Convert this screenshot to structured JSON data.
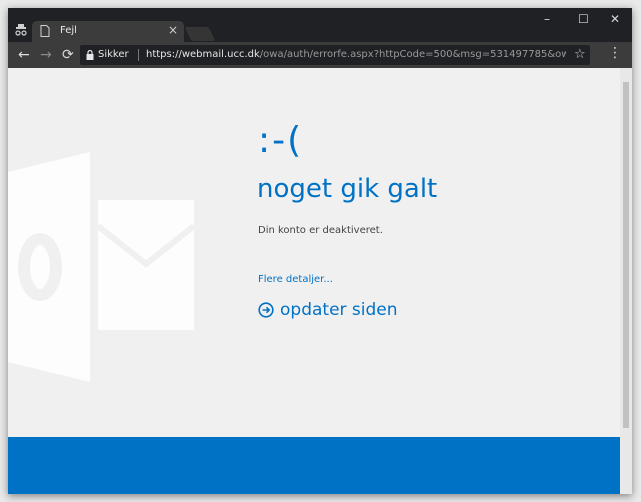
{
  "browser": {
    "tab_title": "Fejl",
    "tab_close": "×",
    "minimize": "–",
    "maximize": "☐",
    "close": "✕",
    "back": "←",
    "forward": "→",
    "reload": "⟳",
    "secure_label": "Sikker",
    "url_host": "https://webmail.ucc.dk",
    "url_path": "/owa/auth/errorfe.aspx?httpCode=500&msg=531497785&owaError=Mic...",
    "star": "☆",
    "menu": "⋮"
  },
  "page": {
    "sad_face": ":-(",
    "headline": "noget gik galt",
    "message": "Din konto er deaktiveret.",
    "more_link": "Flere detaljer...",
    "refresh_link": "opdater siden"
  },
  "colors": {
    "accent": "#0072c6",
    "background": "#f0f0f0"
  },
  "icons": [
    "incognito-icon",
    "page-icon",
    "lock-icon",
    "star-icon",
    "menu-icon",
    "refresh-circle-icon",
    "outlook-logo-icon"
  ]
}
